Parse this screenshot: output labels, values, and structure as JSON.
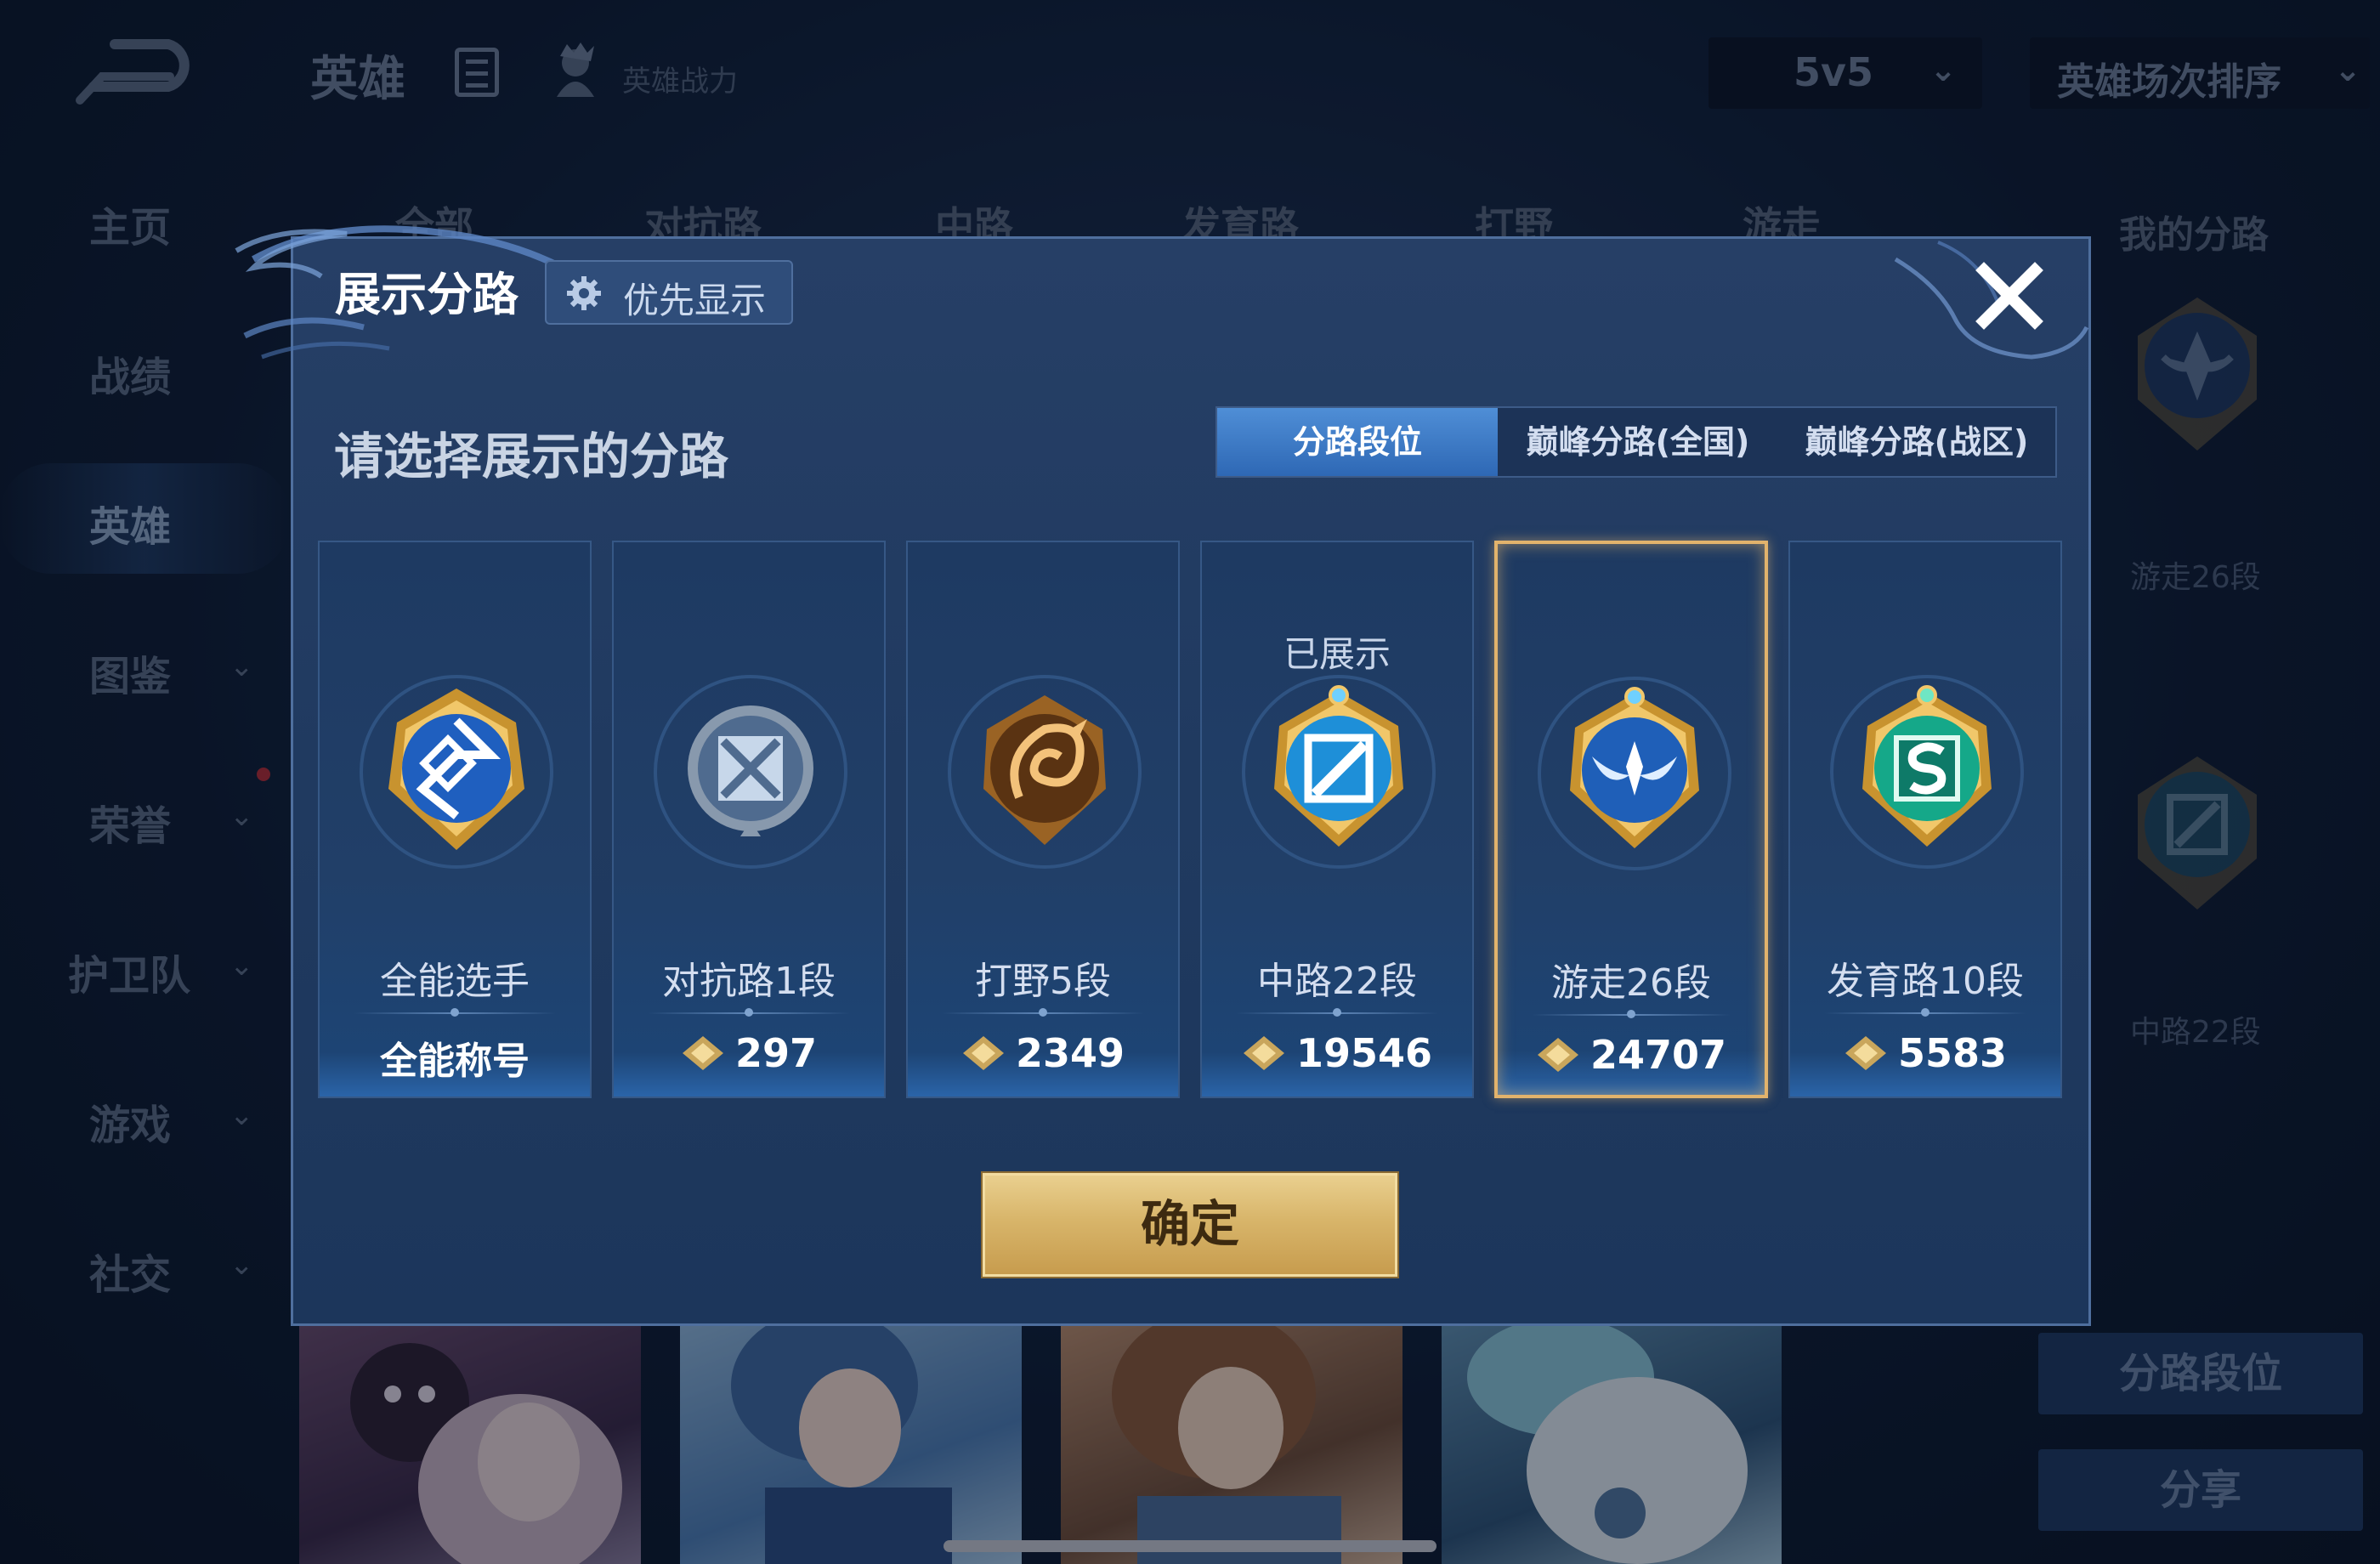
{
  "background": {
    "header": {
      "title": "英雄",
      "power_label": "英雄战力",
      "mode_select": "5v5",
      "sort_select": "英雄场次排序"
    },
    "sidebar": [
      {
        "label": "主页",
        "has_arrow": false
      },
      {
        "label": "战绩",
        "has_arrow": false
      },
      {
        "label": "英雄",
        "has_arrow": false,
        "active": true
      },
      {
        "label": "图鉴",
        "has_arrow": true
      },
      {
        "label": "荣誉",
        "has_arrow": true
      },
      {
        "label": "护卫队",
        "has_arrow": true
      },
      {
        "label": "游戏",
        "has_arrow": true
      },
      {
        "label": "社交",
        "has_arrow": true
      }
    ],
    "tabs": [
      "全部",
      "对抗路",
      "中路",
      "发育路",
      "打野",
      "游走"
    ],
    "right_panel": {
      "title": "我的分路",
      "badge1_caption": "游走26段",
      "badge2_caption": "中路22段",
      "lane_rank_button": "分路段位",
      "share_button": "分享"
    }
  },
  "modal": {
    "title": "展示分路",
    "priority_button": "优先显示",
    "subtitle": "请选择展示的分路",
    "segments": [
      {
        "label": "分路段位",
        "active": true
      },
      {
        "label": "巅峰分路(全国)",
        "active": false
      },
      {
        "label": "巅峰分路(战区)",
        "active": false
      }
    ],
    "cards": [
      {
        "name": "全能选手",
        "value": "全能称号",
        "is_title": true,
        "shown_label": "",
        "selected": false,
        "icon": "all-round-badge-icon",
        "color": "#3a78d8"
      },
      {
        "name": "对抗路1段",
        "value": "297",
        "is_title": false,
        "shown_label": "",
        "selected": false,
        "icon": "clash-lane-badge-icon",
        "color": "#7a8ea8"
      },
      {
        "name": "打野5段",
        "value": "2349",
        "is_title": false,
        "shown_label": "",
        "selected": false,
        "icon": "jungle-badge-icon",
        "color": "#c4832e"
      },
      {
        "name": "中路22段",
        "value": "19546",
        "is_title": false,
        "shown_label": "已展示",
        "selected": false,
        "icon": "mid-lane-badge-icon",
        "color": "#2fa5e4"
      },
      {
        "name": "游走26段",
        "value": "24707",
        "is_title": false,
        "shown_label": "",
        "selected": true,
        "icon": "roam-badge-icon",
        "color": "#2c79d6"
      },
      {
        "name": "发育路10段",
        "value": "5583",
        "is_title": false,
        "shown_label": "",
        "selected": false,
        "icon": "farm-lane-badge-icon",
        "color": "#1fb89a"
      }
    ],
    "confirm_button": "确定"
  },
  "colors": {
    "gold": "#d8b56a",
    "modal_bg": "#233d63",
    "active_tab": "#3f7fcb"
  }
}
